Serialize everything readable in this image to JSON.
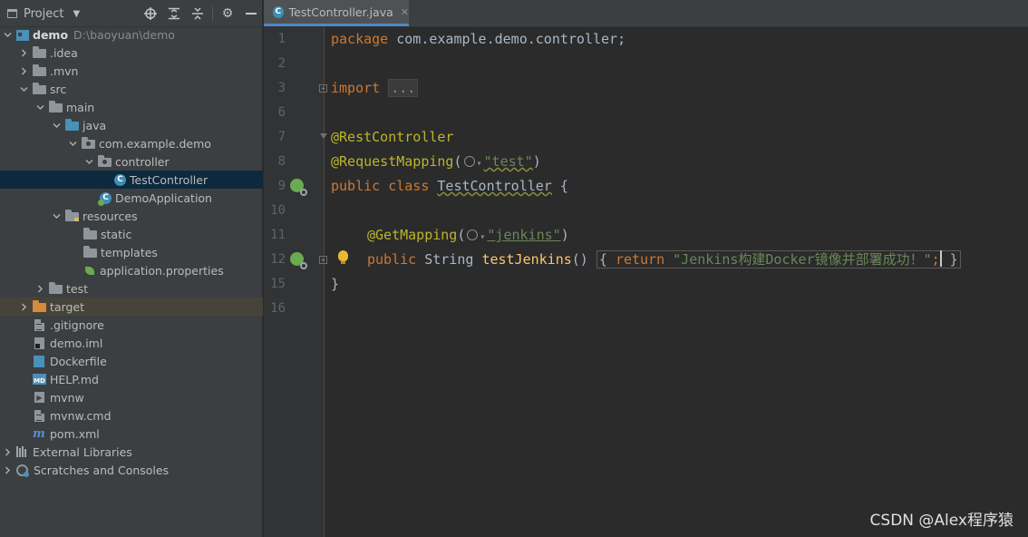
{
  "project_panel": {
    "title": "Project",
    "tree": [
      {
        "label": "demo",
        "hint": "D:\\baoyuan\\demo",
        "type": "module",
        "depth": 0,
        "expanded": true
      },
      {
        "label": ".idea",
        "type": "folder",
        "depth": 1,
        "expanded": false
      },
      {
        "label": ".mvn",
        "type": "folder",
        "depth": 1,
        "expanded": false
      },
      {
        "label": "src",
        "type": "folder",
        "depth": 1,
        "expanded": true
      },
      {
        "label": "main",
        "type": "folder",
        "depth": 2,
        "expanded": true
      },
      {
        "label": "java",
        "type": "folder-blue",
        "depth": 3,
        "expanded": true
      },
      {
        "label": "com.example.demo",
        "type": "package",
        "depth": 4,
        "expanded": true
      },
      {
        "label": "controller",
        "type": "package",
        "depth": 5,
        "expanded": true
      },
      {
        "label": "TestController",
        "type": "java-class",
        "depth": 6,
        "selected": true
      },
      {
        "label": "DemoApplication",
        "type": "spring-class",
        "depth": 5
      },
      {
        "label": "resources",
        "type": "resources",
        "depth": 3,
        "expanded": true
      },
      {
        "label": "static",
        "type": "folder",
        "depth": 4
      },
      {
        "label": "templates",
        "type": "folder",
        "depth": 4
      },
      {
        "label": "application.properties",
        "type": "properties",
        "depth": 4
      },
      {
        "label": "test",
        "type": "folder",
        "depth": 2,
        "expanded": false
      },
      {
        "label": "target",
        "type": "folder-orange",
        "depth": 1,
        "expanded": false,
        "excluded": true
      },
      {
        "label": ".gitignore",
        "type": "file",
        "depth": 1
      },
      {
        "label": "demo.iml",
        "type": "iml",
        "depth": 1
      },
      {
        "label": "Dockerfile",
        "type": "docker",
        "depth": 1
      },
      {
        "label": "HELP.md",
        "type": "md",
        "depth": 1
      },
      {
        "label": "mvnw",
        "type": "terminal",
        "depth": 1
      },
      {
        "label": "mvnw.cmd",
        "type": "file-lines",
        "depth": 1
      },
      {
        "label": "pom.xml",
        "type": "maven",
        "depth": 1
      },
      {
        "label": "External Libraries",
        "type": "libraries",
        "depth": 0,
        "expanded": false
      },
      {
        "label": "Scratches and Consoles",
        "type": "scratches",
        "depth": 0,
        "expanded": false
      }
    ]
  },
  "editor": {
    "tab_label": "TestController.java",
    "line_numbers": [
      "1",
      "2",
      "3",
      "6",
      "7",
      "8",
      "9",
      "10",
      "11",
      "12",
      "15",
      "16"
    ],
    "code": {
      "l1_kw": "package",
      "l1_rest": " com.example.demo.controller;",
      "l3_kw": "import",
      "l3_fold": "...",
      "l7_ann": "@RestController",
      "l8_ann": "@RequestMapping",
      "l8_str": "\"test\"",
      "l9_kw": "public class",
      "l9_name": "TestController",
      "l11_ann": "@GetMapping",
      "l11_str": "\"jenkins\"",
      "l12_kw": "public",
      "l12_type": " String ",
      "l12_fn": "testJenkins",
      "l12_ret": "return",
      "l12_str": "\"Jenkins构建Docker镜像并部署成功！\"",
      "l15": "}"
    }
  },
  "watermark": "CSDN @Alex程序猿",
  "colors": {
    "background": "#2b2b2b",
    "panel": "#3c3f41",
    "selection": "#0d293e",
    "keyword": "#cc7832",
    "annotation": "#bbb529",
    "string": "#6a8759",
    "method": "#ffc66d"
  }
}
